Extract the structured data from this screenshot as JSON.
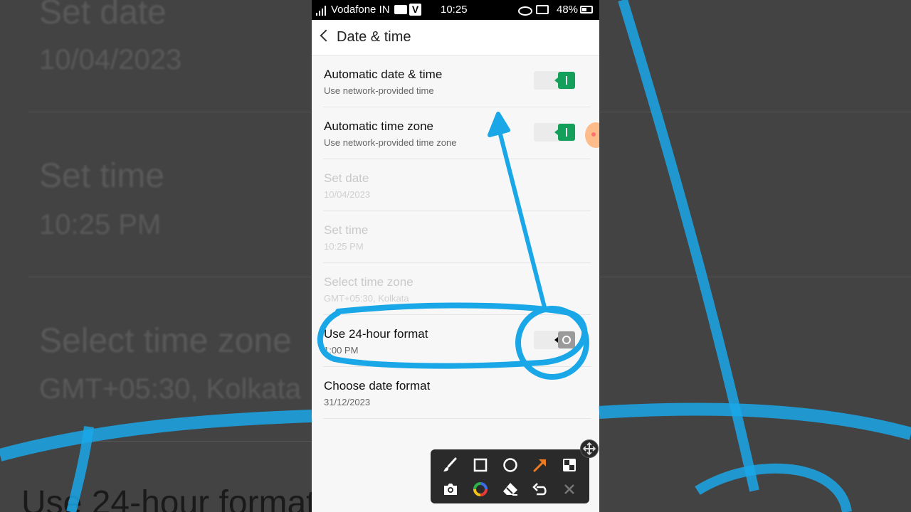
{
  "status_bar": {
    "carrier": "Vodafone IN",
    "time": "10:25",
    "battery": "48%"
  },
  "header": {
    "title": "Date & time"
  },
  "settings": [
    {
      "title": "Automatic date & time",
      "subtitle": "Use network-provided time",
      "toggle": "on",
      "enabled": true
    },
    {
      "title": "Automatic time zone",
      "subtitle": "Use network-provided time zone",
      "toggle": "on",
      "enabled": true
    },
    {
      "title": "Set date",
      "subtitle": "10/04/2023",
      "enabled": false
    },
    {
      "title": "Set time",
      "subtitle": "10:25 PM",
      "enabled": false
    },
    {
      "title": "Select time zone",
      "subtitle": "GMT+05:30, Kolkata",
      "enabled": false
    },
    {
      "title": "Use 24-hour format",
      "subtitle": "1:00 PM",
      "toggle": "off",
      "enabled": true
    },
    {
      "title": "Choose date format",
      "subtitle": "31/12/2023",
      "enabled": true
    }
  ],
  "background_zoom": {
    "set_date": "Set date",
    "date_value": "10/04/2023",
    "set_time": "Set time",
    "time_value": "10:25 PM",
    "select_tz": "Select time zone",
    "tz_value": "GMT+05:30, Kolkata",
    "use24": "Use 24-hour format"
  },
  "colors": {
    "toggle_on": "#14a05a",
    "annotation": "#1aa7e8",
    "arrow_tool": "#f07a22"
  },
  "toolbar_icons": [
    "brush-icon",
    "rectangle-icon",
    "circle-icon",
    "arrow-icon",
    "mosaic-icon",
    "camera-icon",
    "color-wheel-icon",
    "eraser-icon",
    "undo-icon",
    "close-icon"
  ]
}
